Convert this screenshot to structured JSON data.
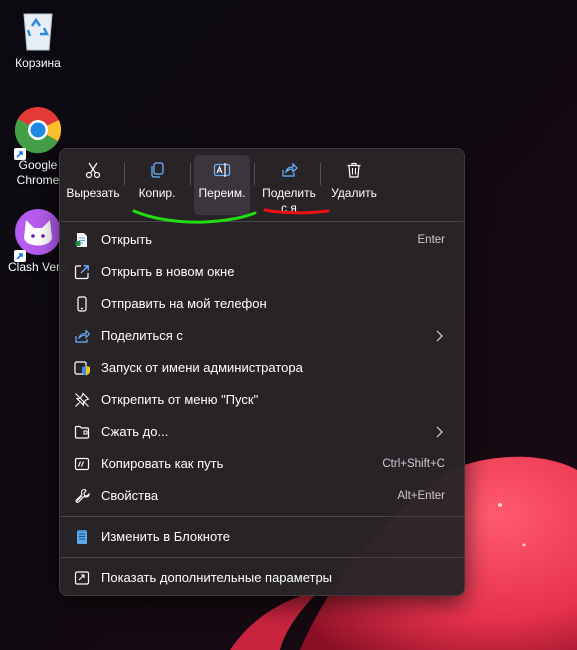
{
  "desktop": {
    "icons": [
      {
        "label": "Корзина"
      },
      {
        "label": "Google Chrome"
      },
      {
        "label": "Clash Verge"
      }
    ]
  },
  "context_menu": {
    "toolbar": {
      "cut_label": "Вырезать",
      "copy_label": "Копир.",
      "rename_label": "Переим.",
      "share_label": "Поделитьс я",
      "delete_label": "Удалить"
    },
    "items": [
      {
        "label": "Открыть",
        "shortcut": "Enter"
      },
      {
        "label": "Открыть в новом окне"
      },
      {
        "label": "Отправить на мой телефон"
      },
      {
        "label": "Поделиться с"
      },
      {
        "label": "Запуск от имени администратора"
      },
      {
        "label": "Открепить от меню \"Пуск\""
      },
      {
        "label": "Сжать до..."
      },
      {
        "label": "Копировать как путь",
        "shortcut": "Ctrl+Shift+C"
      },
      {
        "label": "Свойства",
        "shortcut": "Alt+Enter"
      },
      {
        "label": "Изменить в Блокноте"
      },
      {
        "label": "Показать дополнительные параметры"
      }
    ]
  },
  "colors": {
    "menu_bg": "#282428",
    "annotation_green": "#22dd11",
    "annotation_red": "#ee1111",
    "wallpaper_accent": "#f2455e"
  }
}
